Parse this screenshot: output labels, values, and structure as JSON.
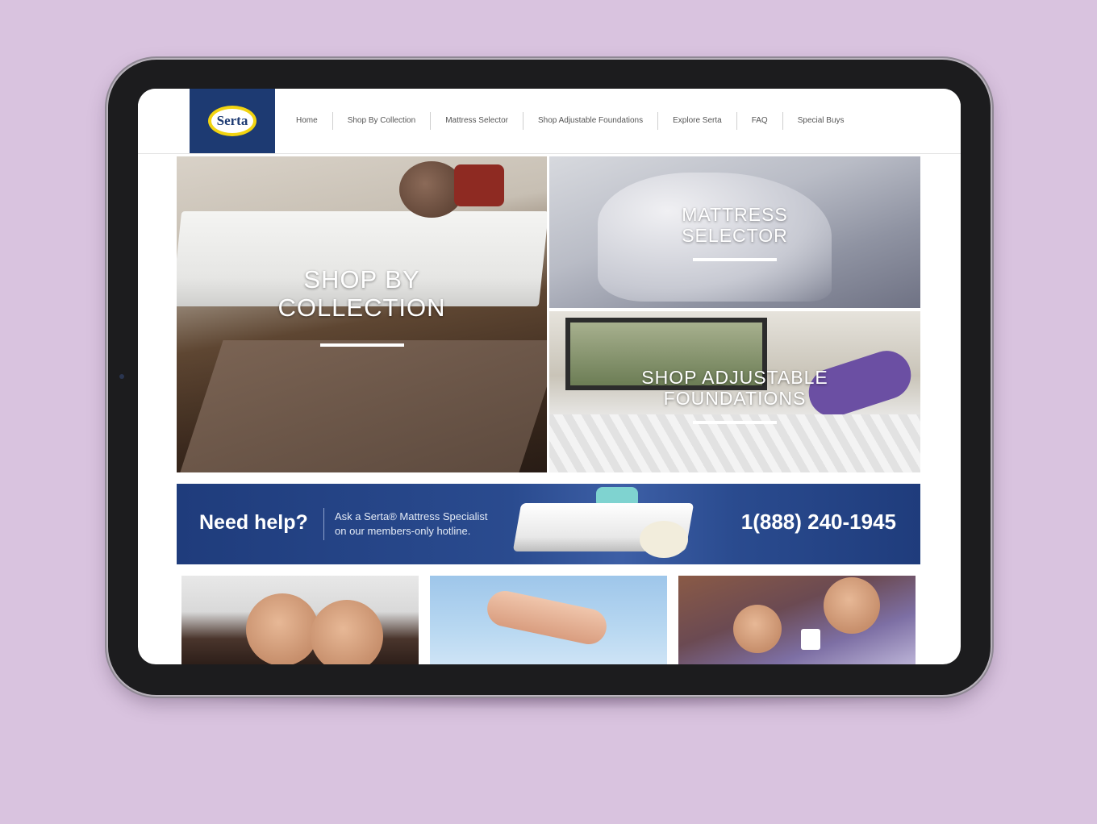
{
  "site": {
    "logo_text": "Serta",
    "nav": [
      {
        "label": "Home"
      },
      {
        "label": "Shop By Collection"
      },
      {
        "label": "Mattress Selector"
      },
      {
        "label": "Shop Adjustable Foundations"
      },
      {
        "label": "Explore Serta"
      },
      {
        "label": "FAQ"
      },
      {
        "label": "Special Buys"
      }
    ]
  },
  "hero": {
    "collection": {
      "line1": "SHOP BY",
      "line2": "COLLECTION"
    },
    "selector": {
      "line1": "MATTRESS",
      "line2": "SELECTOR"
    },
    "adjustable": {
      "line1": "SHOP ADJUSTABLE",
      "line2": "FOUNDATIONS"
    }
  },
  "help": {
    "title": "Need help?",
    "sub_line1": "Ask a Serta® Mattress Specialist",
    "sub_line2": "on our members-only hotline.",
    "phone": "1(888) 240-1945"
  },
  "colors": {
    "background": "#d9c3df",
    "brand_navy": "#1d3a72",
    "brand_yellow": "#f2d410"
  }
}
